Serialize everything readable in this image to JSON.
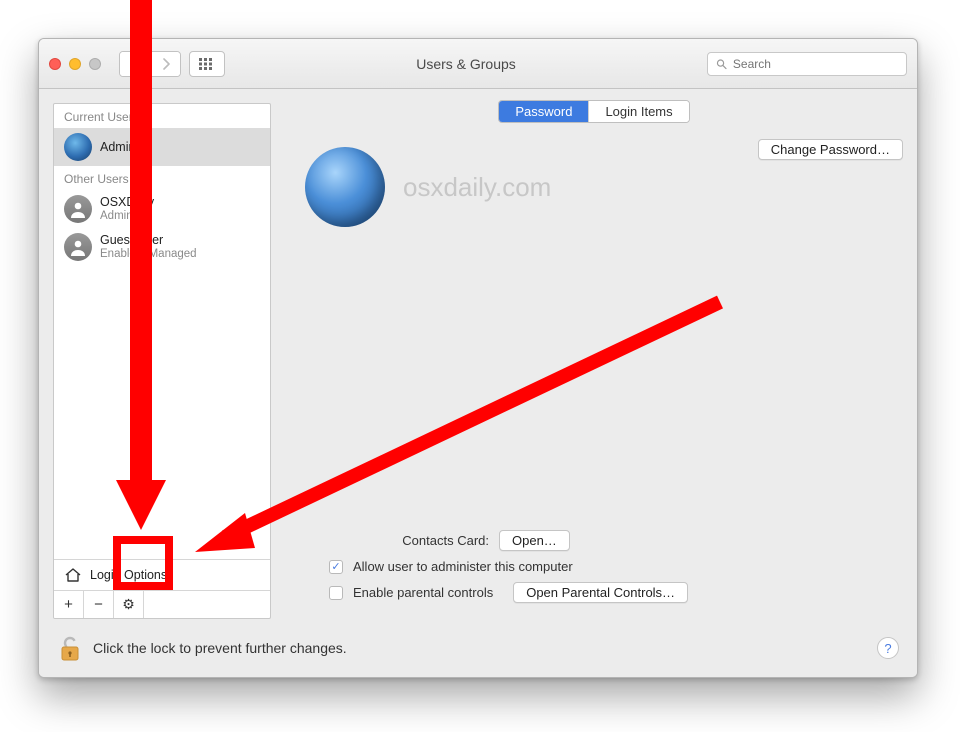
{
  "toolbar": {
    "title": "Users & Groups",
    "search_placeholder": "Search"
  },
  "sidebar": {
    "section_current": "Current User",
    "section_other": "Other Users",
    "login_options_label": "Login Options",
    "users": [
      {
        "name": "Admin",
        "role": "",
        "selected": true,
        "avatar": "earth"
      },
      {
        "name": "OSXDaily",
        "role": "Admin",
        "selected": false,
        "avatar": "generic"
      },
      {
        "name": "Guest User",
        "role": "Enabled, Managed",
        "selected": false,
        "avatar": "generic"
      }
    ],
    "buttons": {
      "add": "+",
      "remove": "−",
      "gear": "⚙"
    }
  },
  "tabs": {
    "password": "Password",
    "login_items": "Login Items",
    "active": "password"
  },
  "profile": {
    "watermark": "osxdaily.com",
    "change_password_label": "Change Password…"
  },
  "form": {
    "contacts_label": "Contacts Card:",
    "open_label": "Open…",
    "admin_checkbox_label": "Allow user to administer this computer",
    "admin_checked": true,
    "parental_checkbox_label": "Enable parental controls",
    "parental_checked": false,
    "parental_button_label": "Open Parental Controls…"
  },
  "footer": {
    "lock_text": "Click the lock to prevent further changes."
  }
}
